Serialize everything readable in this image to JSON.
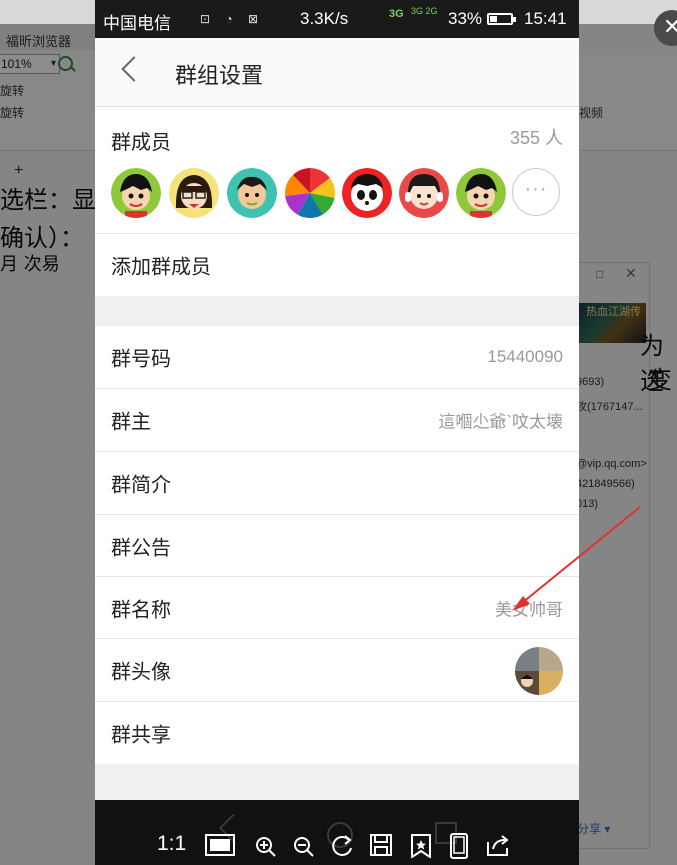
{
  "background_app": {
    "tab_title": "福昕浏览器",
    "zoom_value": "101%",
    "toolbar_items": [
      "旋转",
      "旋转"
    ],
    "plus": "+",
    "doc_lines": [
      "选栏：显",
      "确认）：",
      "月 次易"
    ],
    "right_text_1": "为选",
    "right_text_2": "变",
    "right_small": [
      "视频"
    ],
    "panel_items": [
      "9693)",
      "攻(1767147...",
      "@vip.qq.com>",
      "421849566)",
      "013)"
    ],
    "thumb_title": "热血江湖传",
    "share_label": "分享"
  },
  "status_bar": {
    "carrier": "中国电信",
    "speed": "3.3K/s",
    "net_type": "3G",
    "net_sub": "3G 2G",
    "battery": "33%",
    "time": "15:41"
  },
  "nav": {
    "title": "群组设置"
  },
  "members": {
    "label": "群成员",
    "count": "355 人",
    "more": "···",
    "add_label": "添加群成员"
  },
  "info_rows": [
    {
      "label": "群号码",
      "value": "15440090"
    },
    {
      "label": "群主",
      "value": "這嗰尐爺`呅太壊"
    },
    {
      "label": "群简介",
      "value": ""
    },
    {
      "label": "群公告",
      "value": ""
    },
    {
      "label": "群名称",
      "value": "美女帅哥"
    },
    {
      "label": "群头像",
      "value": ""
    },
    {
      "label": "群共享",
      "value": ""
    }
  ],
  "viewer_toolbar": {
    "ratio": "1:1",
    "icons": [
      "fit-screen-icon",
      "zoom-in-icon",
      "zoom-out-icon",
      "rotate-icon",
      "save-icon",
      "bookmark-icon",
      "phone-frame-icon",
      "share-icon"
    ]
  },
  "colors": {
    "annotation_arrow": "#e03030",
    "status_bar_bg": "#1a1a1a",
    "nav_bg": "#fafafa"
  }
}
